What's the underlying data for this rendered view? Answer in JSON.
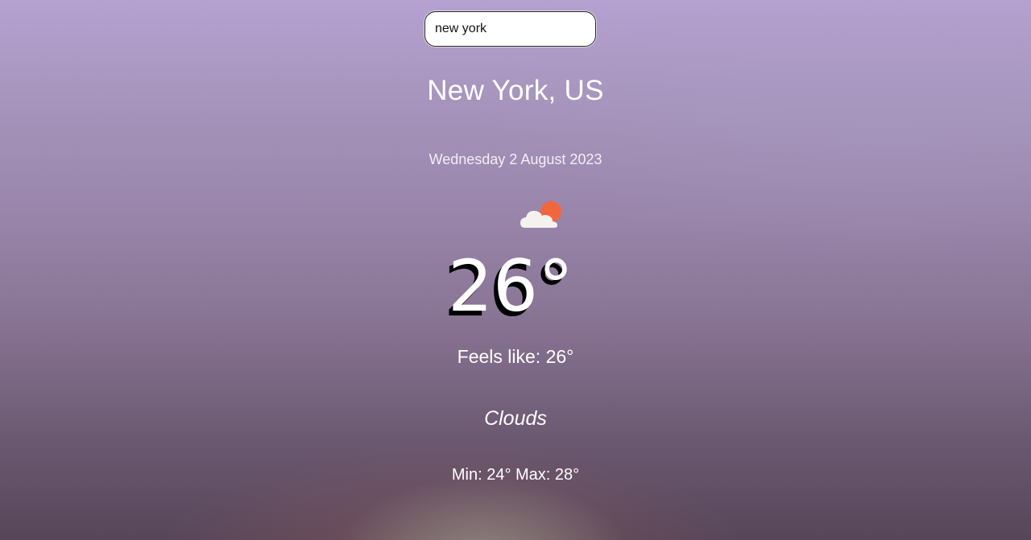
{
  "search": {
    "value": "new york"
  },
  "location": {
    "name": "New York, US"
  },
  "date": "Wednesday 2 August 2023",
  "weather": {
    "icon": "partly-cloudy-icon",
    "temperature": "26°",
    "feels_like": "Feels like: 26°",
    "description": "Clouds",
    "min_max": "Min: 24° Max: 28°"
  },
  "colors": {
    "sun": "#f0673c",
    "cloud": "#f4f2ef",
    "background_top": "#b5a1d0",
    "background_bottom": "#574659"
  }
}
